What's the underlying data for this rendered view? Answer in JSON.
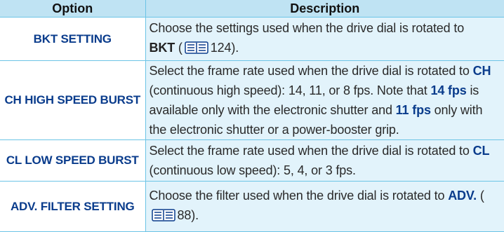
{
  "headers": {
    "option": "Option",
    "description": "Description"
  },
  "rows": [
    {
      "option": "BKT SETTING",
      "desc": {
        "t1": "Choose the settings used when the drive dial is rotated to",
        "kw1": "BKT",
        "t2": " (",
        "page": "124",
        "t3": ")."
      }
    },
    {
      "option": "CH HIGH SPEED BURST",
      "desc": {
        "t1": "Select the frame rate used when the drive dial is rotated to ",
        "kw1": "CH",
        "t2": " (continuous high speed): 14, 11, or 8 fps.  Note that ",
        "kw2": "14 fps",
        "t3": " is available only with the electronic shutter and ",
        "kw3": "11 fps",
        "t4": " only with the electronic shutter or a power-booster grip."
      }
    },
    {
      "option": "CL LOW SPEED BURST",
      "desc": {
        "t1": "Select the frame rate used when the drive dial is rotated to ",
        "kw1": "CL",
        "t2": " (continuous low speed): 5, 4, or 3 fps."
      }
    },
    {
      "option": "ADV. FILTER SETTING",
      "desc": {
        "t1": "Choose the filter used when the drive dial is rotated to ",
        "kw1": "ADV.",
        "t2": " (",
        "page": "88",
        "t3": ")."
      }
    }
  ],
  "icons": {
    "page_ref": "book-reference-icon"
  },
  "colors": {
    "header_bg": "#bfe3f3",
    "desc_bg": "#e2f3fb",
    "rule": "#6cc4e6",
    "keyword": "#0a3c8c"
  }
}
